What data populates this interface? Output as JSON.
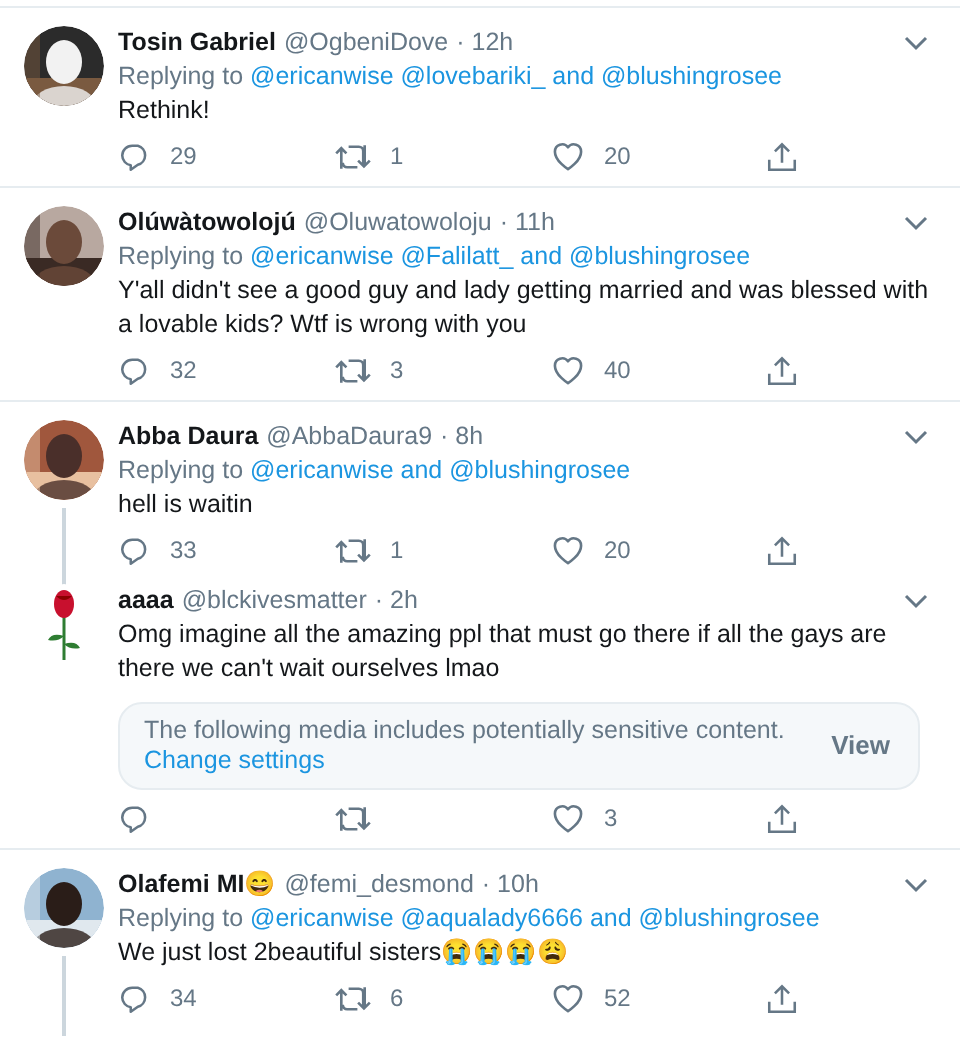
{
  "tweets": [
    {
      "name": "Tosin Gabriel",
      "handle": "@OgbeniDove",
      "time": "· 12h",
      "replying_prefix": "Replying to",
      "replying_to": "@ericanwise @lovebariki_ and @blushingrosee",
      "text": "Rethink!",
      "replies": "29",
      "retweets": "1",
      "likes": "20",
      "connector_below": false
    },
    {
      "name": "Olúwàtowolojú",
      "handle": "@Oluwatowoloju",
      "time": "· 11h",
      "replying_prefix": "Replying to",
      "replying_to": "@ericanwise @Falilatt_ and @blushingrosee",
      "text": "Y'all didn't see a good guy and lady getting married and was blessed with a lovable kids? Wtf is wrong with you",
      "replies": "32",
      "retweets": "3",
      "likes": "40",
      "connector_below": false
    },
    {
      "name": "Abba Daura",
      "handle": "@AbbaDaura9",
      "time": "· 8h",
      "replying_prefix": "Replying to",
      "replying_to": "@ericanwise and @blushingrosee",
      "text": "hell is waitin",
      "replies": "33",
      "retweets": "1",
      "likes": "20",
      "connector_below": true
    },
    {
      "name": "aaaa",
      "handle": "@blckivesmatter",
      "time": "· 2h",
      "text": "Omg imagine all the amazing ppl that must go there if all the gays are there we can't wait ourselves lmao",
      "media_warning": {
        "text": "The following media includes potentially sensitive content.",
        "link": "Change settings",
        "button": "View"
      },
      "likes": "3",
      "connector_below": false
    },
    {
      "name": "Olafemi MI😄",
      "handle": "@femi_desmond",
      "time": "· 10h",
      "replying_prefix": "Replying to",
      "replying_to": "@ericanwise @aqualady6666 and @blushingrosee",
      "text": "We just lost 2beautiful sisters😭😭😭😩",
      "replies": "34",
      "retweets": "6",
      "likes": "52",
      "connector_below": true
    }
  ]
}
